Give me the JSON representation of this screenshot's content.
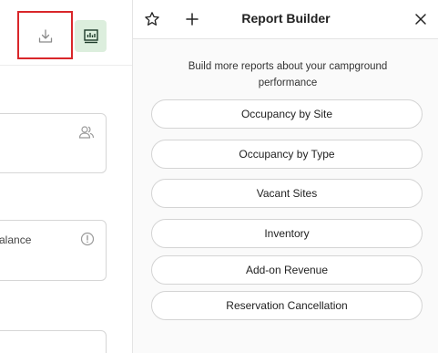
{
  "left": {
    "card2_label": "Balance"
  },
  "panel": {
    "title": "Report Builder",
    "intro": "Build more reports about your campground performance",
    "reports": [
      "Occupancy by Site",
      "Occupancy by Type",
      "Vacant Sites",
      "Inventory",
      "Add-on Revenue",
      "Reservation Cancellation"
    ]
  },
  "colors": {
    "highlight": "#d9262a",
    "active_button_bg": "#dceedd"
  },
  "icons": {
    "download": "download-icon",
    "report": "bar-chart-icon",
    "star": "star-icon",
    "plus": "plus-icon",
    "close": "close-icon",
    "users": "users-icon",
    "info": "info-icon"
  }
}
